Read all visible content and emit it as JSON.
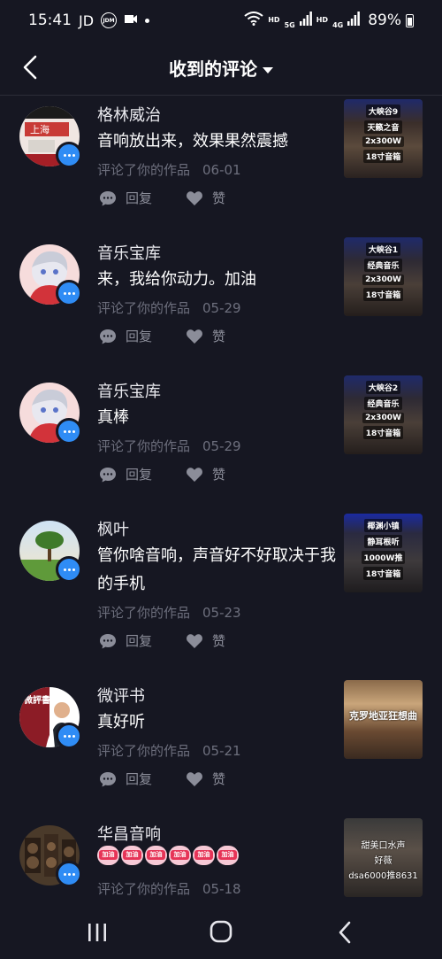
{
  "status_bar": {
    "time": "15:41",
    "carrier": "JD",
    "jd_badge": "JDM",
    "battery": "89%",
    "hd1": "HD",
    "hd2": "HD",
    "net1": "5G",
    "net2": "4G"
  },
  "header": {
    "title": "收到的评论"
  },
  "colors": {
    "background": "#161722",
    "badge": "#2f8cf5",
    "meta": "#6d6f7d"
  },
  "comments": [
    {
      "username": "格林威治",
      "text": "音响放出来，效果果然震撼",
      "action": "评论了你的作品",
      "date": "06-01",
      "reply": "回复",
      "like": "赞",
      "thumb_lines": [
        "大峡谷9",
        "天籁之音",
        "2x300W",
        "18寸音箱"
      ]
    },
    {
      "username": "音乐宝库",
      "text": "来，我给你动力。加油",
      "action": "评论了你的作品",
      "date": "05-29",
      "reply": "回复",
      "like": "赞",
      "thumb_lines": [
        "大峡谷1",
        "经典音乐",
        "2x300W",
        "18寸音箱"
      ]
    },
    {
      "username": "音乐宝库",
      "text": "真棒",
      "action": "评论了你的作品",
      "date": "05-29",
      "reply": "回复",
      "like": "赞",
      "thumb_lines": [
        "大峡谷2",
        "经典音乐",
        "2x300W",
        "18寸音箱"
      ]
    },
    {
      "username": "枫叶",
      "text": "管你啥音响，声音好不好取决于我的手机",
      "action": "评论了你的作品",
      "date": "05-23",
      "reply": "回复",
      "like": "赞",
      "thumb_lines": [
        "椰渊小镇",
        "静耳根听",
        "1000W推",
        "18寸音箱"
      ]
    },
    {
      "username": "微评书",
      "text": "真好听",
      "action": "评论了你的作品",
      "date": "05-21",
      "reply": "回复",
      "like": "赞",
      "thumb_single": "克罗地亚狂想曲",
      "avatar_text": "微評書"
    },
    {
      "username": "华昌音响",
      "emoji_label": "加油",
      "emoji_count": 6,
      "action": "评论了你的作品",
      "date": "05-18",
      "thumb_lines": [
        "甜美口水声",
        "好薇",
        "dsa6000推8631"
      ]
    }
  ]
}
